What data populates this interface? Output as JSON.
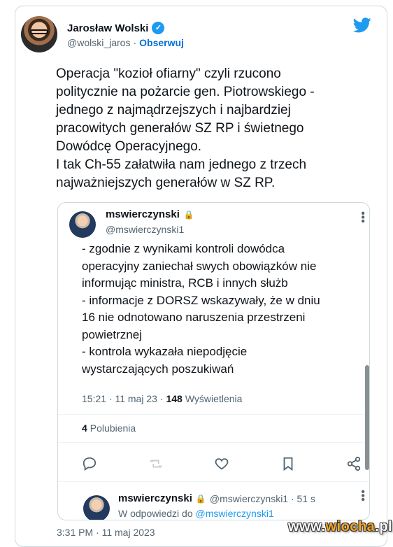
{
  "author": {
    "display_name": "Jarosław Wolski",
    "verified_icon": "✓",
    "handle": "@wolski_jaros",
    "separator": "·",
    "follow_label": "Obserwuj"
  },
  "tweet": {
    "text": "Operacja \"kozioł ofiarny\" czyli rzucono\npolitycznie na pożarcie gen. Piotrowskiego -\njednego z najmądrzejszych i najbardziej\npracowitych generałów  SZ RP i świetnego\nDowódcę Operacyjnego.\nI tak Ch-55 załatwiła nam jednego z trzech\nnajważniejszych generałów w SZ RP.",
    "timestamp": "3:31 PM · 11 maj 2023"
  },
  "quoted_tweet": {
    "display_name": "mswierczynski",
    "lock_icon": "🔒",
    "handle": "@mswierczynski1",
    "more_icon": "•••",
    "text": "- zgodnie z wynikami kontroli dowódca\noperacyjny zaniechał swych obowiązków nie\ninformując ministra, RCB i innych służb\n- informacje z DORSZ wskazywały, że w dniu\n16 nie odnotowano naruszenia przestrzeni\npowietrznej\n- kontrola wykazała niepodjęcie\nwystarczających poszukiwań",
    "meta_time": "15:21 · 11 maj 23 ·",
    "views_count": "148",
    "views_label": "Wyświetlenia",
    "likes_count": "4",
    "likes_label": "Polubienia"
  },
  "reply": {
    "display_name": "mswierczynski",
    "lock_icon": "🔒",
    "handle": "@mswierczynski1 · 51 s",
    "reply_prefix": "W odpowiedzi do",
    "reply_mention": "@mswierczynski1"
  },
  "watermark": {
    "prefix": "www.",
    "main": "wiocha",
    "suffix": ".pl"
  },
  "colors": {
    "accent_blue": "#1d9bf0",
    "follow_blue": "#006fd6",
    "secondary_text": "#536471",
    "border": "#cfd9de"
  }
}
